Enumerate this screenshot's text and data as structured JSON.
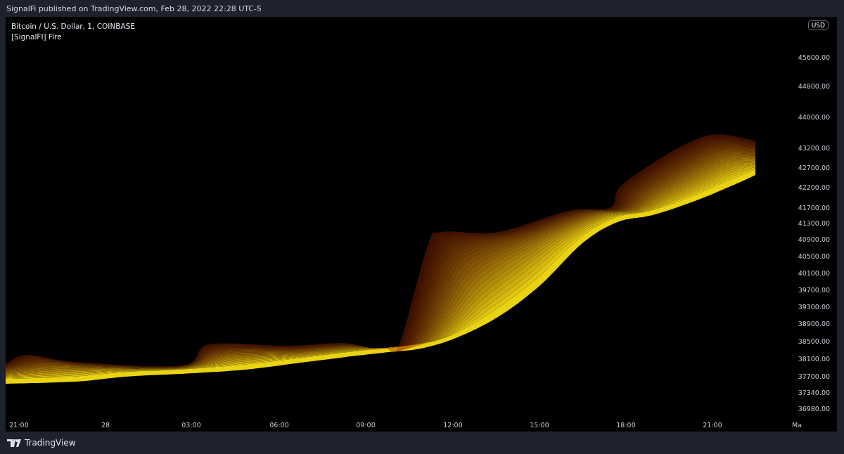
{
  "header": {
    "text": "SignalFi published on TradingView.com, Feb 28, 2022 22:28 UTC-5"
  },
  "legend": {
    "symbol": "Bitcoin / U.S. Dollar, 1, COINBASE",
    "indicator": "[SignalFI] Fire"
  },
  "currency_badge": "USD",
  "price_axis": [
    "45600.00",
    "44800.00",
    "44000.00",
    "43200.00",
    "42700.00",
    "42200.00",
    "41700.00",
    "41300.00",
    "40900.00",
    "40500.00",
    "40100.00",
    "39700.00",
    "39300.00",
    "38900.00",
    "38500.00",
    "38100.00",
    "37700.00",
    "37340.00",
    "36980.00"
  ],
  "time_axis": [
    "21:00",
    "28",
    "03:00",
    "06:00",
    "09:00",
    "12:00",
    "15:00",
    "18:00",
    "21:00",
    "Ma"
  ],
  "footer": {
    "brand": "TradingView"
  }
}
